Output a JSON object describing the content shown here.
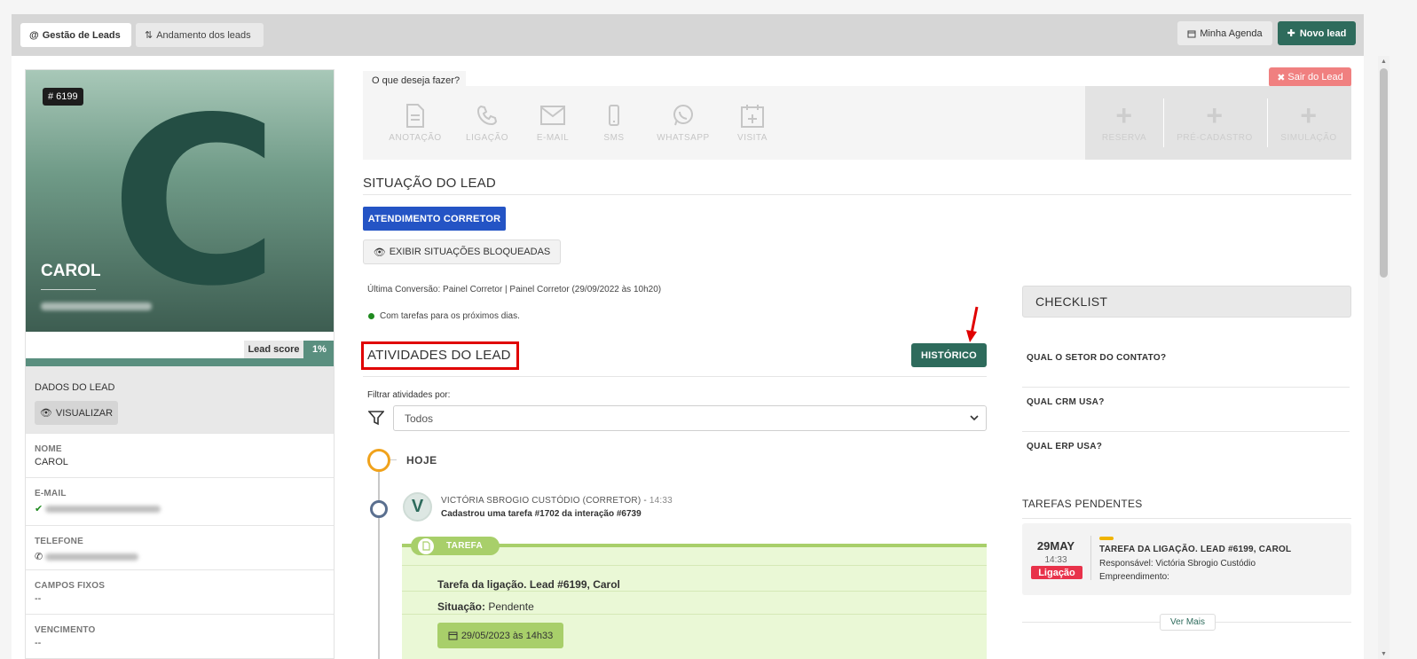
{
  "tabs": {
    "active": "Gestão de Leads",
    "inactive": "Andamento dos leads"
  },
  "header_buttons": {
    "agenda": "Minha Agenda",
    "novo_lead": "Novo lead"
  },
  "lead": {
    "id": "# 6199",
    "initial": "C",
    "name": "CAROL",
    "score_label": "Lead score",
    "score_value": "1%",
    "dados_title": "DADOS DO LEAD",
    "visualizar": "VISUALIZAR",
    "fields": [
      {
        "label": "NOME",
        "value": "CAROL"
      },
      {
        "label": "E-MAIL",
        "value": ""
      },
      {
        "label": "TELEFONE",
        "value": ""
      },
      {
        "label": "CAMPOS FIXOS",
        "value": "--"
      },
      {
        "label": "VENCIMENTO",
        "value": "--"
      }
    ]
  },
  "actions": {
    "prompt": "O que deseja fazer?",
    "exit": "Sair do Lead",
    "items": [
      "ANOTAÇÃO",
      "LIGAÇÃO",
      "E-MAIL",
      "SMS",
      "WHATSAPP",
      "VISITA"
    ],
    "right_items": [
      "RESERVA",
      "PRÉ-CADASTRO",
      "SIMULAÇÃO"
    ]
  },
  "situacao": {
    "title": "SITUAÇÃO DO LEAD",
    "status_button": "ATENDIMENTO CORRETOR",
    "exibir_button": "EXIBIR SITUAÇÕES BLOQUEADAS",
    "last_conversion": "Última Conversão: Painel Corretor | Painel Corretor (29/09/2022 às 10h20)",
    "tasks_status": "Com tarefas para os próximos dias."
  },
  "atividades": {
    "title": "ATIVIDADES DO LEAD",
    "historico": "HISTÓRICO",
    "filter_label": "Filtrar atividades por:",
    "filter_value": "Todos",
    "today": "HOJE",
    "entry": {
      "avatar": "V",
      "author": "VICTÓRIA SBROGIO CUSTÓDIO (CORRETOR) -",
      "time": "14:33",
      "description": "Cadastrou uma tarefa #1702 da interação #6739",
      "pill": "TAREFA",
      "task_title": "Tarefa da ligação. Lead #6199, Carol",
      "situacao_label": "Situação:",
      "situacao_value": "Pendente",
      "date": "29/05/2023 às 14h33"
    }
  },
  "checklist": {
    "title": "CHECKLIST",
    "questions": [
      "QUAL O SETOR DO CONTATO?",
      "QUAL CRM USA?",
      "QUAL ERP USA?"
    ]
  },
  "tarefas_pendentes": {
    "title": "TAREFAS PENDENTES",
    "day": "29MAY",
    "hour": "14:33",
    "badge": "Ligação",
    "task_title": "TAREFA DA LIGAÇÃO. LEAD #6199, CAROL",
    "responsavel": "Responsável: Victória Sbrogio Custódio",
    "empreendimento": "Empreendimento:",
    "ver_mais": "Ver Mais"
  },
  "colors": {
    "primary_green": "#2e6b5c",
    "blue": "#2454c5",
    "red_highlight": "#e00000",
    "exit_red": "#f08080",
    "task_green": "#a8cf6a",
    "badge_red": "#e8324a"
  }
}
